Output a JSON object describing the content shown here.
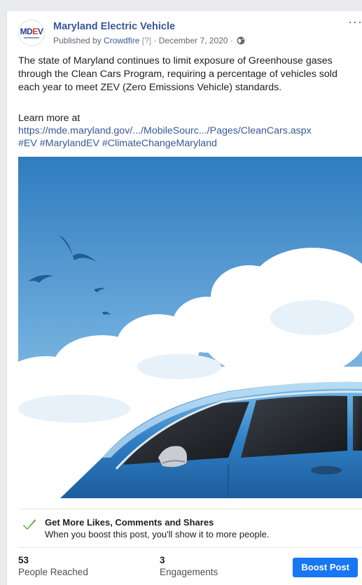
{
  "post": {
    "page_name": "Maryland Electric Vehicle",
    "avatar_logo": "MDEV",
    "published_prefix": "Published by ",
    "publisher": "Crowdfire",
    "help_marker": "[?]",
    "date_text": " · December 7, 2020 · ",
    "privacy_icon": "globe-icon",
    "more_label": "···",
    "body": "The state of Maryland continues to limit exposure of Greenhouse gases through the Clean Cars Program, requiring a percentage of vehicles sold each year to meet ZEV (Zero Emissions Vehicle) standards.",
    "learn_more": "Learn more at",
    "url": "https://mde.maryland.gov/.../MobileSourc.../Pages/CleanCars.aspx",
    "hashtags": "#EV #MarylandEV #ClimateChangeMaryland",
    "image": {
      "sky_color": "#3a86c2",
      "car_color": "#2f7fc4"
    }
  },
  "boost": {
    "icon": "checkmark-icon",
    "title": "Get More Likes, Comments and Shares",
    "subtitle": "When you boost this post, you'll show it to more people."
  },
  "stats": {
    "reached_value": "53",
    "reached_label": "People Reached",
    "engagements_value": "3",
    "engagements_label": "Engagements",
    "boost_button": "Boost Post",
    "button_color": "#1877f2"
  }
}
